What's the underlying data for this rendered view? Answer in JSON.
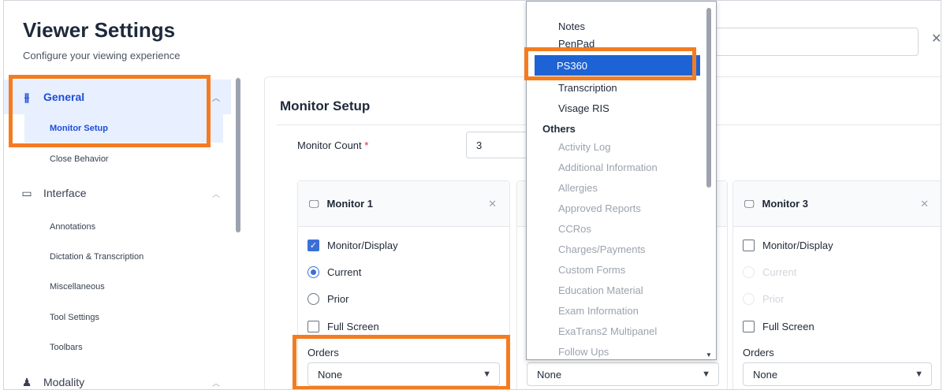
{
  "header": {
    "title": "Viewer Settings",
    "subtitle": "Configure your viewing experience"
  },
  "sidebar": {
    "general": {
      "label": "General",
      "icon": "sliders-icon"
    },
    "monitor_setup": "Monitor Setup",
    "close_behavior": "Close Behavior",
    "interface": {
      "label": "Interface",
      "icon": "monitor-icon"
    },
    "interface_items": [
      "Annotations",
      "Dictation & Transcription",
      "Miscellaneous",
      "Tool Settings",
      "Toolbars"
    ],
    "modality": {
      "label": "Modality",
      "icon": "person-icon"
    }
  },
  "main": {
    "section_title": "Monitor Setup",
    "monitor_count_label": "Monitor Count",
    "required_mark": "*",
    "monitor_count_value": "3",
    "monitors": [
      {
        "title": "Monitor 1",
        "monitor_display": "Monitor/Display",
        "monitor_display_checked": true,
        "current": "Current",
        "current_selected": true,
        "prior": "Prior",
        "full_screen": "Full Screen",
        "full_screen_checked": false,
        "orders_label": "Orders",
        "orders_value": "None"
      },
      {
        "orders_value": "None"
      },
      {
        "title": "Monitor 3",
        "monitor_display": "Monitor/Display",
        "monitor_display_checked": false,
        "current": "Current",
        "prior": "Prior",
        "full_screen": "Full Screen",
        "full_screen_checked": false,
        "orders_label": "Orders",
        "orders_value": "None"
      }
    ]
  },
  "dropdown": {
    "items_top": [
      "Notes",
      "PenPad"
    ],
    "selected": "PS360",
    "items_after": [
      "Transcription",
      "Visage RIS"
    ],
    "others_header": "Others",
    "others_items": [
      "Activity Log",
      "Additional Information",
      "Allergies",
      "Approved Reports",
      "CCRos",
      "Charges/Payments",
      "Custom Forms",
      "Education Material",
      "Exam Information",
      "ExaTrans2 Multipanel",
      "Follow Ups"
    ]
  },
  "colors": {
    "highlight": "#f47c20",
    "accent": "#1d63d6",
    "active_bg": "#e8efff"
  }
}
